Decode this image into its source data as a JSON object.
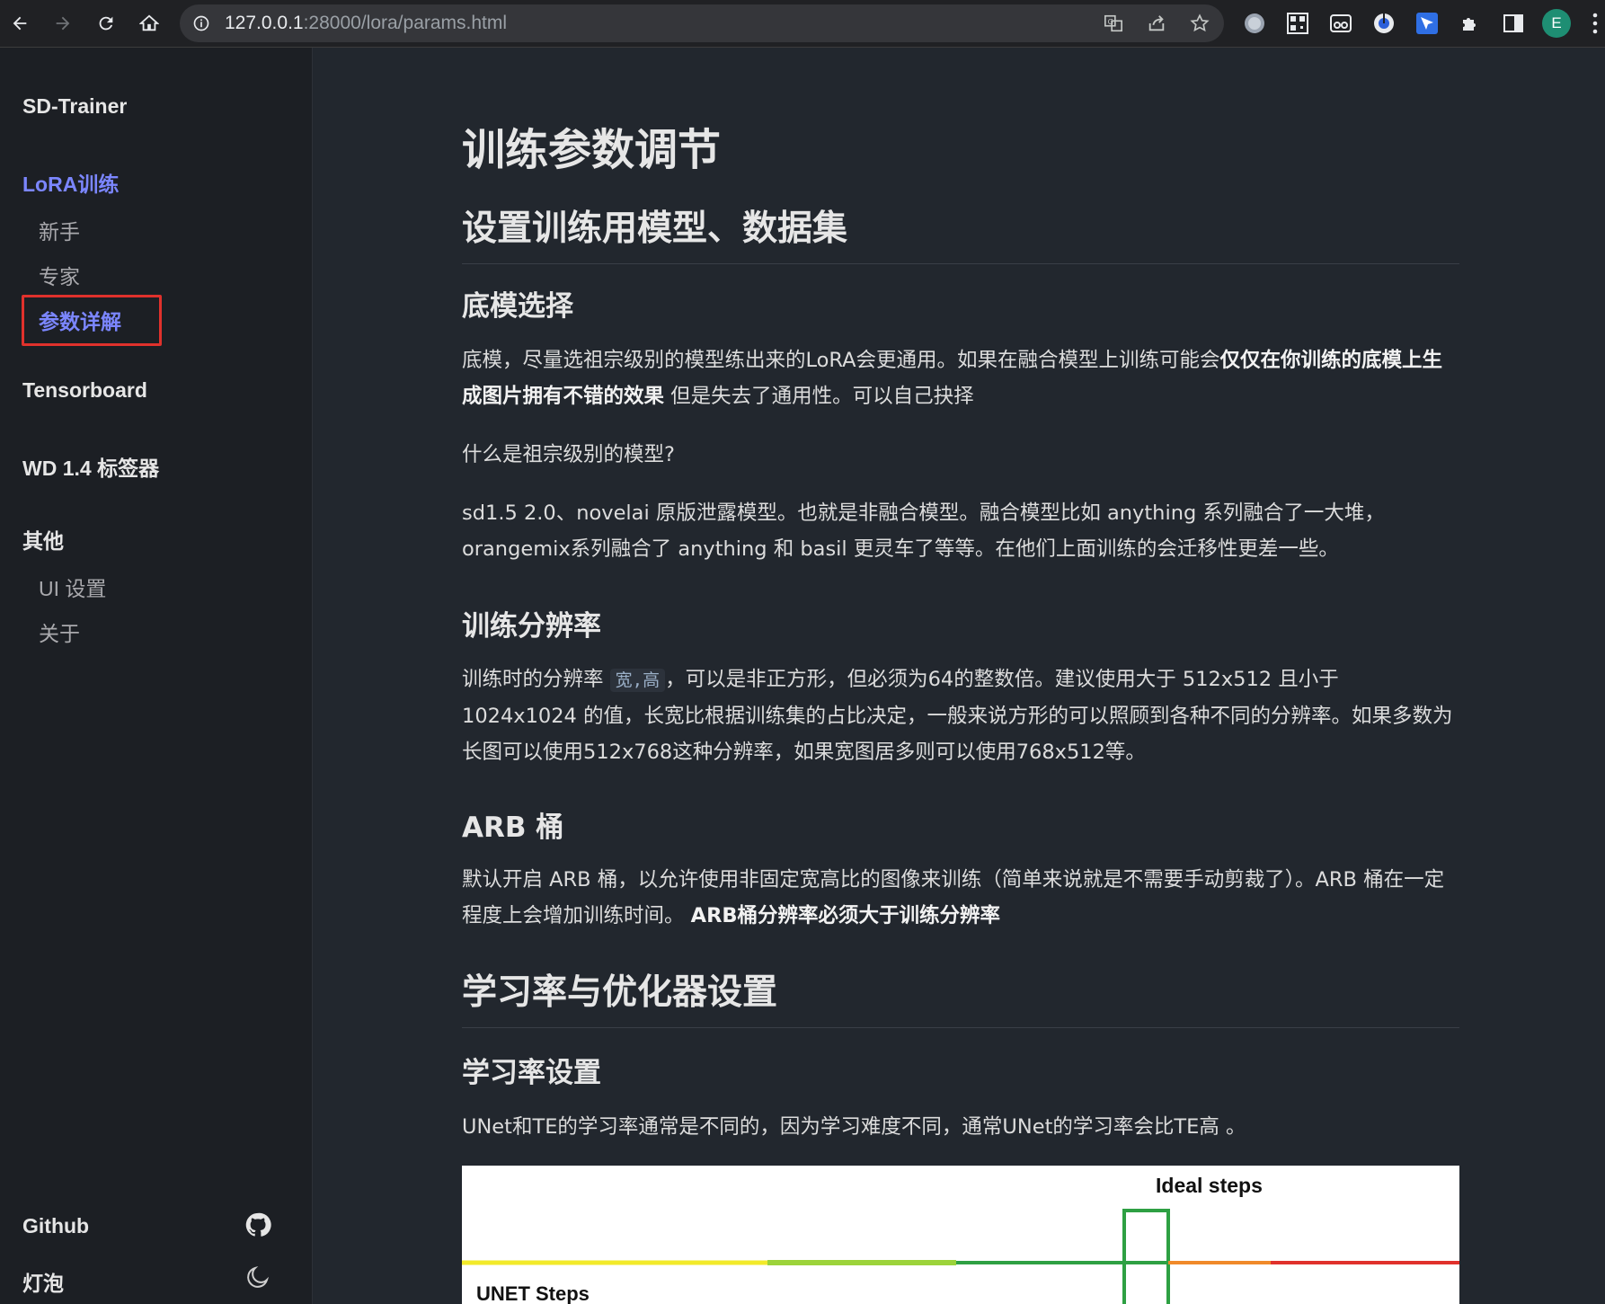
{
  "browser": {
    "url_host": "127.0.0.1",
    "url_rest": ":28000/lora/params.html",
    "profile_initial": "E"
  },
  "sidebar": {
    "site_title": "SD-Trainer",
    "lora_group": "LoRA训练",
    "lora_items": [
      "新手",
      "专家",
      "参数详解"
    ],
    "tensorboard": "Tensorboard",
    "tagger": "WD 1.4 标签器",
    "other_group": "其他",
    "other_items": [
      "UI 设置",
      "关于"
    ],
    "github": "Github",
    "theme": "灯泡"
  },
  "main": {
    "title": "训练参数调节",
    "section1": "设置训练用模型、数据集",
    "base_model_heading": "底模选择",
    "base_model_p1_a": "底模，尽量选祖宗级别的模型练出来的LoRA会更通用。如果在融合模型上训练可能会",
    "base_model_p1_bold": "仅仅在你训练的底模上生成图片拥有不错的效果",
    "base_model_p1_b": " 但是失去了通用性。可以自己抉择",
    "base_model_p2": "什么是祖宗级别的模型?",
    "base_model_p3": "sd1.5 2.0、novelai 原版泄露模型。也就是非融合模型。融合模型比如 anything 系列融合了一大堆，orangemix系列融合了 anything 和 basil 更灵车了等等。在他们上面训练的会迁移性更差一些。",
    "resolution_heading": "训练分辨率",
    "resolution_p_a": "训练时的分辨率 ",
    "resolution_code": "宽,高",
    "resolution_p_b": "，可以是非正方形，但必须为64的整数倍。建议使用大于 512x512 且小于 1024x1024 的值，长宽比根据训练集的占比决定，一般来说方形的可以照顾到各种不同的分辨率。如果多数为长图可以使用512x768这种分辨率，如果宽图居多则可以使用768x512等。",
    "arb_heading": "ARB 桶",
    "arb_p_a": "默认开启 ARB 桶，以允许使用非固定宽高比的图像来训练（简单来说就是不需要手动剪裁了）。ARB 桶在一定程度上会增加训练时间。 ",
    "arb_p_bold": "ARB桶分辨率必须大于训练分辨率",
    "section2": "学习率与优化器设置",
    "lr_heading": "学习率设置",
    "lr_p": "UNet和TE的学习率通常是不同的，因为学习难度不同，通常UNet的学习率会比TE高 。",
    "figure": {
      "ideal_label": "Ideal steps",
      "unet_label": "UNET Steps"
    }
  }
}
